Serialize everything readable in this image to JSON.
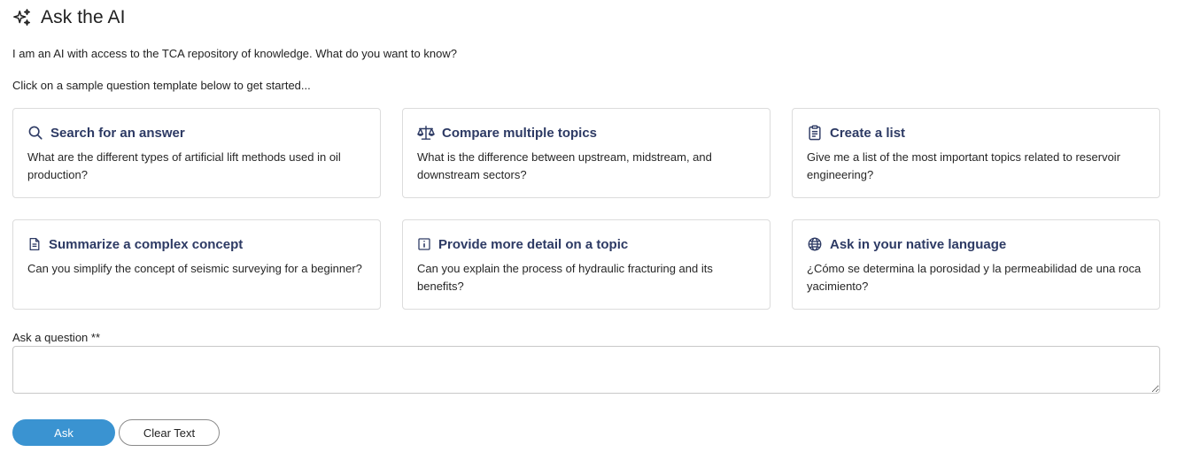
{
  "header": {
    "title": "Ask the AI",
    "icon": "sparkles-icon"
  },
  "intro": "I am an AI with access to the TCA repository of knowledge. What do you want to know?",
  "subintro": "Click on a sample question template below to get started...",
  "cards": [
    {
      "icon": "search-icon",
      "title": "Search for an answer",
      "text": "What are the different types of artificial lift methods used in oil production?"
    },
    {
      "icon": "scale-icon",
      "title": "Compare multiple topics",
      "text": "What is the difference between upstream, midstream, and downstream sectors?"
    },
    {
      "icon": "clipboard-list-icon",
      "title": "Create a list",
      "text": "Give me a list of the most important topics related to reservoir engineering?"
    },
    {
      "icon": "document-icon",
      "title": "Summarize a complex concept",
      "text": "Can you simplify the concept of seismic surveying for a beginner?"
    },
    {
      "icon": "info-icon",
      "title": "Provide more detail on a topic",
      "text": "Can you explain the process of hydraulic fracturing and its benefits?"
    },
    {
      "icon": "globe-icon",
      "title": "Ask in your native language",
      "text": "¿Cómo se determina la porosidad y la permeabilidad de una roca yacimiento?"
    }
  ],
  "question": {
    "label": "Ask a question **",
    "value": "",
    "placeholder": ""
  },
  "buttons": {
    "ask": "Ask",
    "clear": "Clear Text"
  },
  "colors": {
    "accent": "#3a93d1",
    "card_title": "#2d3a64",
    "card_border": "#dcdcdc"
  }
}
